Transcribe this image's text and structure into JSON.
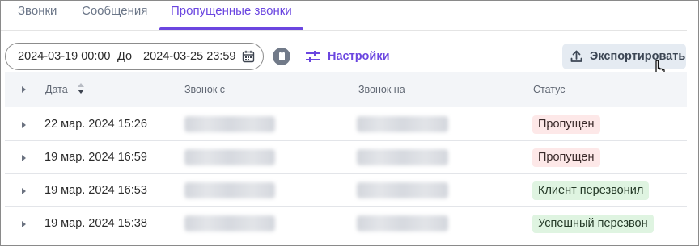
{
  "tabs": [
    {
      "label": "Звонки"
    },
    {
      "label": "Сообщения"
    },
    {
      "label": "Пропущенные звонки"
    }
  ],
  "filter": {
    "from": "2024-03-19 00:00",
    "to_label": "До",
    "until": "2024-03-25 23:59"
  },
  "toolbar": {
    "settings_label": "Настройки",
    "export_label": "Экспортировать"
  },
  "table": {
    "columns": [
      "Дата",
      "Звонок с",
      "Звонок на",
      "Статус"
    ],
    "rows": [
      {
        "date": "22 мар. 2024 15:26",
        "status": "Пропущен",
        "status_type": "missed"
      },
      {
        "date": "19 мар. 2024 16:59",
        "status": "Пропущен",
        "status_type": "missed"
      },
      {
        "date": "19 мар. 2024 16:53",
        "status": "Клиент перезвонил",
        "status_type": "success"
      },
      {
        "date": "19 мар. 2024 15:38",
        "status": "Успешный перезвон",
        "status_type": "success"
      }
    ]
  },
  "colors": {
    "accent": "#6b46e0",
    "missed_badge_bg": "#fde8e8",
    "success_badge_bg": "#dff4e1"
  }
}
